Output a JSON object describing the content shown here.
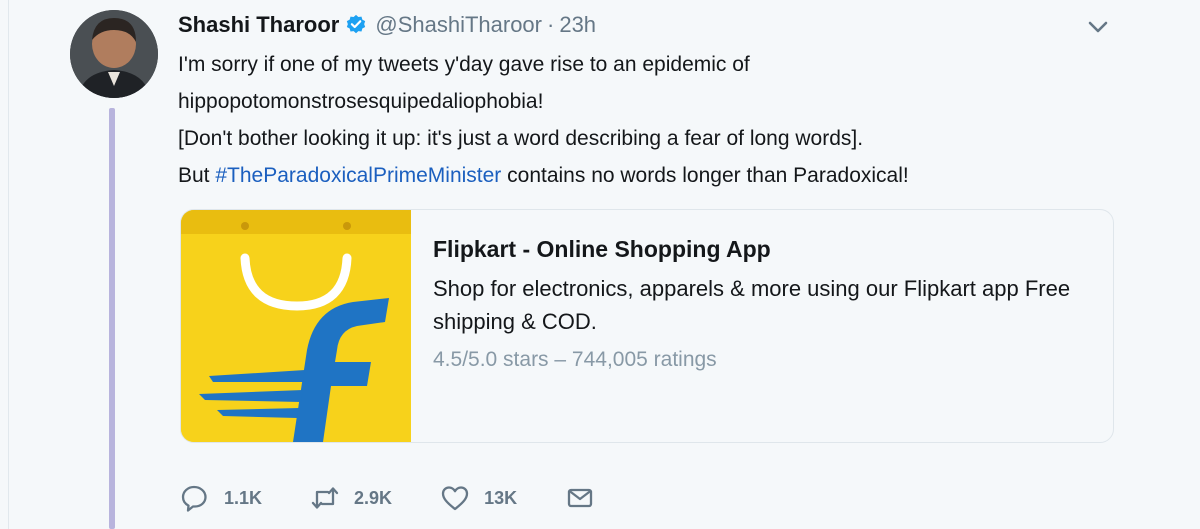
{
  "tweet": {
    "author_name": "Shashi Tharoor",
    "handle": "@ShashiTharoor",
    "separator": "·",
    "time": "23h",
    "text_lines": [
      "I'm sorry if one of my tweets y'day gave rise to an epidemic of",
      "hippopotomonstrosesquipedaliophobia!",
      "[Don't bother looking it up: it's just a word describing a fear of long words]."
    ],
    "last_line_prefix": "But ",
    "hashtag": "#TheParadoxicalPrimeMinister",
    "last_line_suffix": " contains no words longer than Paradoxical!"
  },
  "card": {
    "title": "Flipkart - Online Shopping App",
    "description": "Shop for electronics, apparels & more using our Flipkart app Free shipping & COD.",
    "rating": "4.5/5.0 stars – 744,005 ratings",
    "image_icon": "flipkart-logo"
  },
  "actions": {
    "reply_count": "1.1K",
    "retweet_count": "2.9K",
    "like_count": "13K"
  },
  "icons": {
    "verified": "verified-badge-icon",
    "caret": "chevron-down-icon",
    "reply": "reply-icon",
    "retweet": "retweet-icon",
    "like": "heart-icon",
    "dm": "envelope-icon"
  },
  "colors": {
    "background": "#f5f8fa",
    "verified": "#1da1f2",
    "hashtag": "#1b5fbf",
    "thread_line": "#b8b4dd",
    "flipkart_yellow": "#f7d21b",
    "flipkart_blue": "#1f74c4"
  }
}
